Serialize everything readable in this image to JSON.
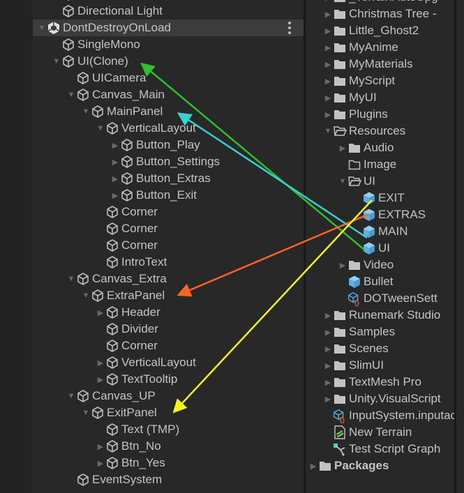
{
  "hierarchy": {
    "rows": [
      {
        "label": "",
        "depth": 2,
        "icon": "gameobject-icon",
        "toggle": "none",
        "partial": true
      },
      {
        "label": "Directional Light",
        "depth": 2,
        "icon": "gameobject-icon",
        "toggle": "none"
      },
      {
        "label": "DontDestroyOnLoad",
        "depth": 1,
        "icon": "unity-scene-icon",
        "toggle": "expanded",
        "scene": true
      },
      {
        "label": "SingleMono",
        "depth": 2,
        "icon": "gameobject-icon",
        "toggle": "none"
      },
      {
        "label": "UI(Clone)",
        "depth": 2,
        "icon": "gameobject-icon",
        "toggle": "expanded"
      },
      {
        "label": "UICamera",
        "depth": 3,
        "icon": "gameobject-icon",
        "toggle": "none"
      },
      {
        "label": "Canvas_Main",
        "depth": 3,
        "icon": "gameobject-icon",
        "toggle": "expanded"
      },
      {
        "label": "MainPanel",
        "depth": 4,
        "icon": "gameobject-icon",
        "toggle": "expanded"
      },
      {
        "label": "VerticalLayout",
        "depth": 5,
        "icon": "gameobject-icon",
        "toggle": "expanded"
      },
      {
        "label": "Button_Play",
        "depth": 6,
        "icon": "gameobject-icon",
        "toggle": "collapsed"
      },
      {
        "label": "Button_Settings",
        "depth": 6,
        "icon": "gameobject-icon",
        "toggle": "collapsed"
      },
      {
        "label": "Button_Extras",
        "depth": 6,
        "icon": "gameobject-icon",
        "toggle": "collapsed"
      },
      {
        "label": "Button_Exit",
        "depth": 6,
        "icon": "gameobject-icon",
        "toggle": "collapsed"
      },
      {
        "label": "Corner",
        "depth": 5,
        "icon": "gameobject-icon",
        "toggle": "none"
      },
      {
        "label": "Corner",
        "depth": 5,
        "icon": "gameobject-icon",
        "toggle": "none"
      },
      {
        "label": "Corner",
        "depth": 5,
        "icon": "gameobject-icon",
        "toggle": "none"
      },
      {
        "label": "IntroText",
        "depth": 5,
        "icon": "gameobject-icon",
        "toggle": "none"
      },
      {
        "label": "Canvas_Extra",
        "depth": 3,
        "icon": "gameobject-icon",
        "toggle": "expanded"
      },
      {
        "label": "ExtraPanel",
        "depth": 4,
        "icon": "gameobject-icon",
        "toggle": "expanded"
      },
      {
        "label": "Header",
        "depth": 5,
        "icon": "gameobject-icon",
        "toggle": "collapsed"
      },
      {
        "label": "Divider",
        "depth": 5,
        "icon": "gameobject-icon",
        "toggle": "none"
      },
      {
        "label": "Corner",
        "depth": 5,
        "icon": "gameobject-icon",
        "toggle": "none"
      },
      {
        "label": "VerticalLayout",
        "depth": 5,
        "icon": "gameobject-icon",
        "toggle": "collapsed"
      },
      {
        "label": "TextTooltip",
        "depth": 5,
        "icon": "gameobject-icon",
        "toggle": "collapsed"
      },
      {
        "label": "Canvas_UP",
        "depth": 3,
        "icon": "gameobject-icon",
        "toggle": "expanded"
      },
      {
        "label": "ExitPanel",
        "depth": 4,
        "icon": "gameobject-icon",
        "toggle": "expanded"
      },
      {
        "label": "Text (TMP)",
        "depth": 5,
        "icon": "gameobject-icon",
        "toggle": "none"
      },
      {
        "label": "Btn_No",
        "depth": 5,
        "icon": "gameobject-icon",
        "toggle": "collapsed"
      },
      {
        "label": "Btn_Yes",
        "depth": 5,
        "icon": "gameobject-icon",
        "toggle": "collapsed"
      },
      {
        "label": "EventSystem",
        "depth": 3,
        "icon": "gameobject-icon",
        "toggle": "none"
      }
    ]
  },
  "project": {
    "rows": [
      {
        "label": "_TerrainAutoUpg",
        "depth": 1,
        "icon": "folder-icon",
        "toggle": "collapsed"
      },
      {
        "label": "Christmas Tree -",
        "depth": 1,
        "icon": "folder-icon",
        "toggle": "collapsed"
      },
      {
        "label": "Little_Ghost2",
        "depth": 1,
        "icon": "folder-icon",
        "toggle": "collapsed"
      },
      {
        "label": "MyAnime",
        "depth": 1,
        "icon": "folder-icon",
        "toggle": "collapsed"
      },
      {
        "label": "MyMaterials",
        "depth": 1,
        "icon": "folder-icon",
        "toggle": "collapsed"
      },
      {
        "label": "MyScript",
        "depth": 1,
        "icon": "folder-icon",
        "toggle": "collapsed"
      },
      {
        "label": "MyUI",
        "depth": 1,
        "icon": "folder-icon",
        "toggle": "collapsed"
      },
      {
        "label": "Plugins",
        "depth": 1,
        "icon": "folder-icon",
        "toggle": "collapsed"
      },
      {
        "label": "Resources",
        "depth": 1,
        "icon": "folder-open-icon",
        "toggle": "expanded"
      },
      {
        "label": "Audio",
        "depth": 2,
        "icon": "folder-icon",
        "toggle": "collapsed"
      },
      {
        "label": "Image",
        "depth": 2,
        "icon": "folder-empty-icon",
        "toggle": "none"
      },
      {
        "label": "UI",
        "depth": 2,
        "icon": "folder-open-icon",
        "toggle": "expanded"
      },
      {
        "label": "EXIT",
        "depth": 3,
        "icon": "prefab-icon",
        "toggle": "none"
      },
      {
        "label": "EXTRAS",
        "depth": 3,
        "icon": "prefab-icon",
        "toggle": "none"
      },
      {
        "label": "MAIN",
        "depth": 3,
        "icon": "prefab-icon",
        "toggle": "none"
      },
      {
        "label": "UI",
        "depth": 3,
        "icon": "prefab-icon",
        "toggle": "none"
      },
      {
        "label": "Video",
        "depth": 2,
        "icon": "folder-icon",
        "toggle": "collapsed"
      },
      {
        "label": "Bullet",
        "depth": 2,
        "icon": "prefab-icon",
        "toggle": "none"
      },
      {
        "label": "DOTweenSett",
        "depth": 2,
        "icon": "scriptable-object-icon",
        "toggle": "none"
      },
      {
        "label": "Runemark Studio",
        "depth": 1,
        "icon": "folder-icon",
        "toggle": "collapsed"
      },
      {
        "label": "Samples",
        "depth": 1,
        "icon": "folder-icon",
        "toggle": "collapsed"
      },
      {
        "label": "Scenes",
        "depth": 1,
        "icon": "folder-icon",
        "toggle": "collapsed"
      },
      {
        "label": "SlimUI",
        "depth": 1,
        "icon": "folder-icon",
        "toggle": "collapsed"
      },
      {
        "label": "TextMesh Pro",
        "depth": 1,
        "icon": "folder-icon",
        "toggle": "collapsed"
      },
      {
        "label": "Unity.VisualScript",
        "depth": 1,
        "icon": "folder-icon",
        "toggle": "collapsed"
      },
      {
        "label": "InputSystem.inputactions",
        "depth": 1,
        "icon": "input-actions-icon",
        "toggle": "none"
      },
      {
        "label": "New Terrain",
        "depth": 1,
        "icon": "terrain-icon",
        "toggle": "none"
      },
      {
        "label": "Test Script Graph",
        "depth": 1,
        "icon": "script-graph-icon",
        "toggle": "none"
      },
      {
        "label": "Packages",
        "depth": 0,
        "icon": "folder-icon",
        "toggle": "collapsed",
        "bold": true
      }
    ]
  },
  "annotations": [
    {
      "from": "UI (prefab)",
      "to": "UI(Clone)",
      "color": "#2ec02e"
    },
    {
      "from": "MAIN (prefab)",
      "to": "MainPanel",
      "color": "#35d2d2"
    },
    {
      "from": "EXTRAS (prefab)",
      "to": "ExtraPanel",
      "color": "#ff6520"
    },
    {
      "from": "EXIT (prefab)",
      "to": "ExitPanel",
      "color": "#f5f51e"
    }
  ],
  "colors": {
    "background": "#282828",
    "scene_row": "#3c3c3c",
    "text": "#c4c4c4",
    "prefab": "#5eb0e0",
    "folder": "#c2c2c2"
  }
}
